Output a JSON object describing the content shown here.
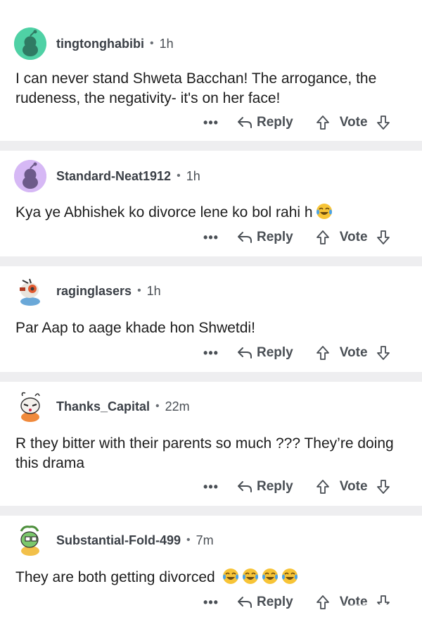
{
  "comments": [
    {
      "username": "tingtonghabibi",
      "time": "1h",
      "text": "I can never stand Shweta Bacchan! The arrogance, the rudeness, the negativity- it's on her face!",
      "avatar_color": "#4fd1a5",
      "avatar_icon": "snoo-avatar-icon"
    },
    {
      "username": "Standard-Neat1912",
      "time": "1h",
      "text": "Kya ye Abhishek ko divorce lene ko bol rahi h",
      "emoji": [
        "face-with-tears-of-joy"
      ],
      "avatar_color": "#c9a8ee",
      "avatar_icon": "snoo-avatar-icon"
    },
    {
      "username": "raginglasers",
      "time": "1h",
      "text": "Par Aap to aage khade hon Shwetdi!",
      "avatar_color": "#e25a2f",
      "avatar_icon": "custom-snoo-avatar-icon"
    },
    {
      "username": "Thanks_Capital",
      "time": "22m",
      "text": "R they bitter with their parents so much ??? They’re doing this drama",
      "avatar_color": "#f08a3c",
      "avatar_icon": "custom-snoo-avatar-icon"
    },
    {
      "username": "Substantial-Fold-499",
      "time": "7m",
      "text": "They are both getting divorced",
      "emoji": [
        "face-with-tears-of-joy",
        "face-with-tears-of-joy",
        "face-with-tears-of-joy",
        "face-with-tears-of-joy"
      ],
      "avatar_color": "#7bc86c",
      "avatar_icon": "custom-snoo-avatar-icon"
    }
  ],
  "actions": {
    "more": "•••",
    "reply": "Reply",
    "vote": "Vote"
  },
  "separator": "•",
  "colors": {
    "text": "#1c1c1c",
    "meta": "#4a4f55",
    "separator_band": "#eeeef0"
  }
}
